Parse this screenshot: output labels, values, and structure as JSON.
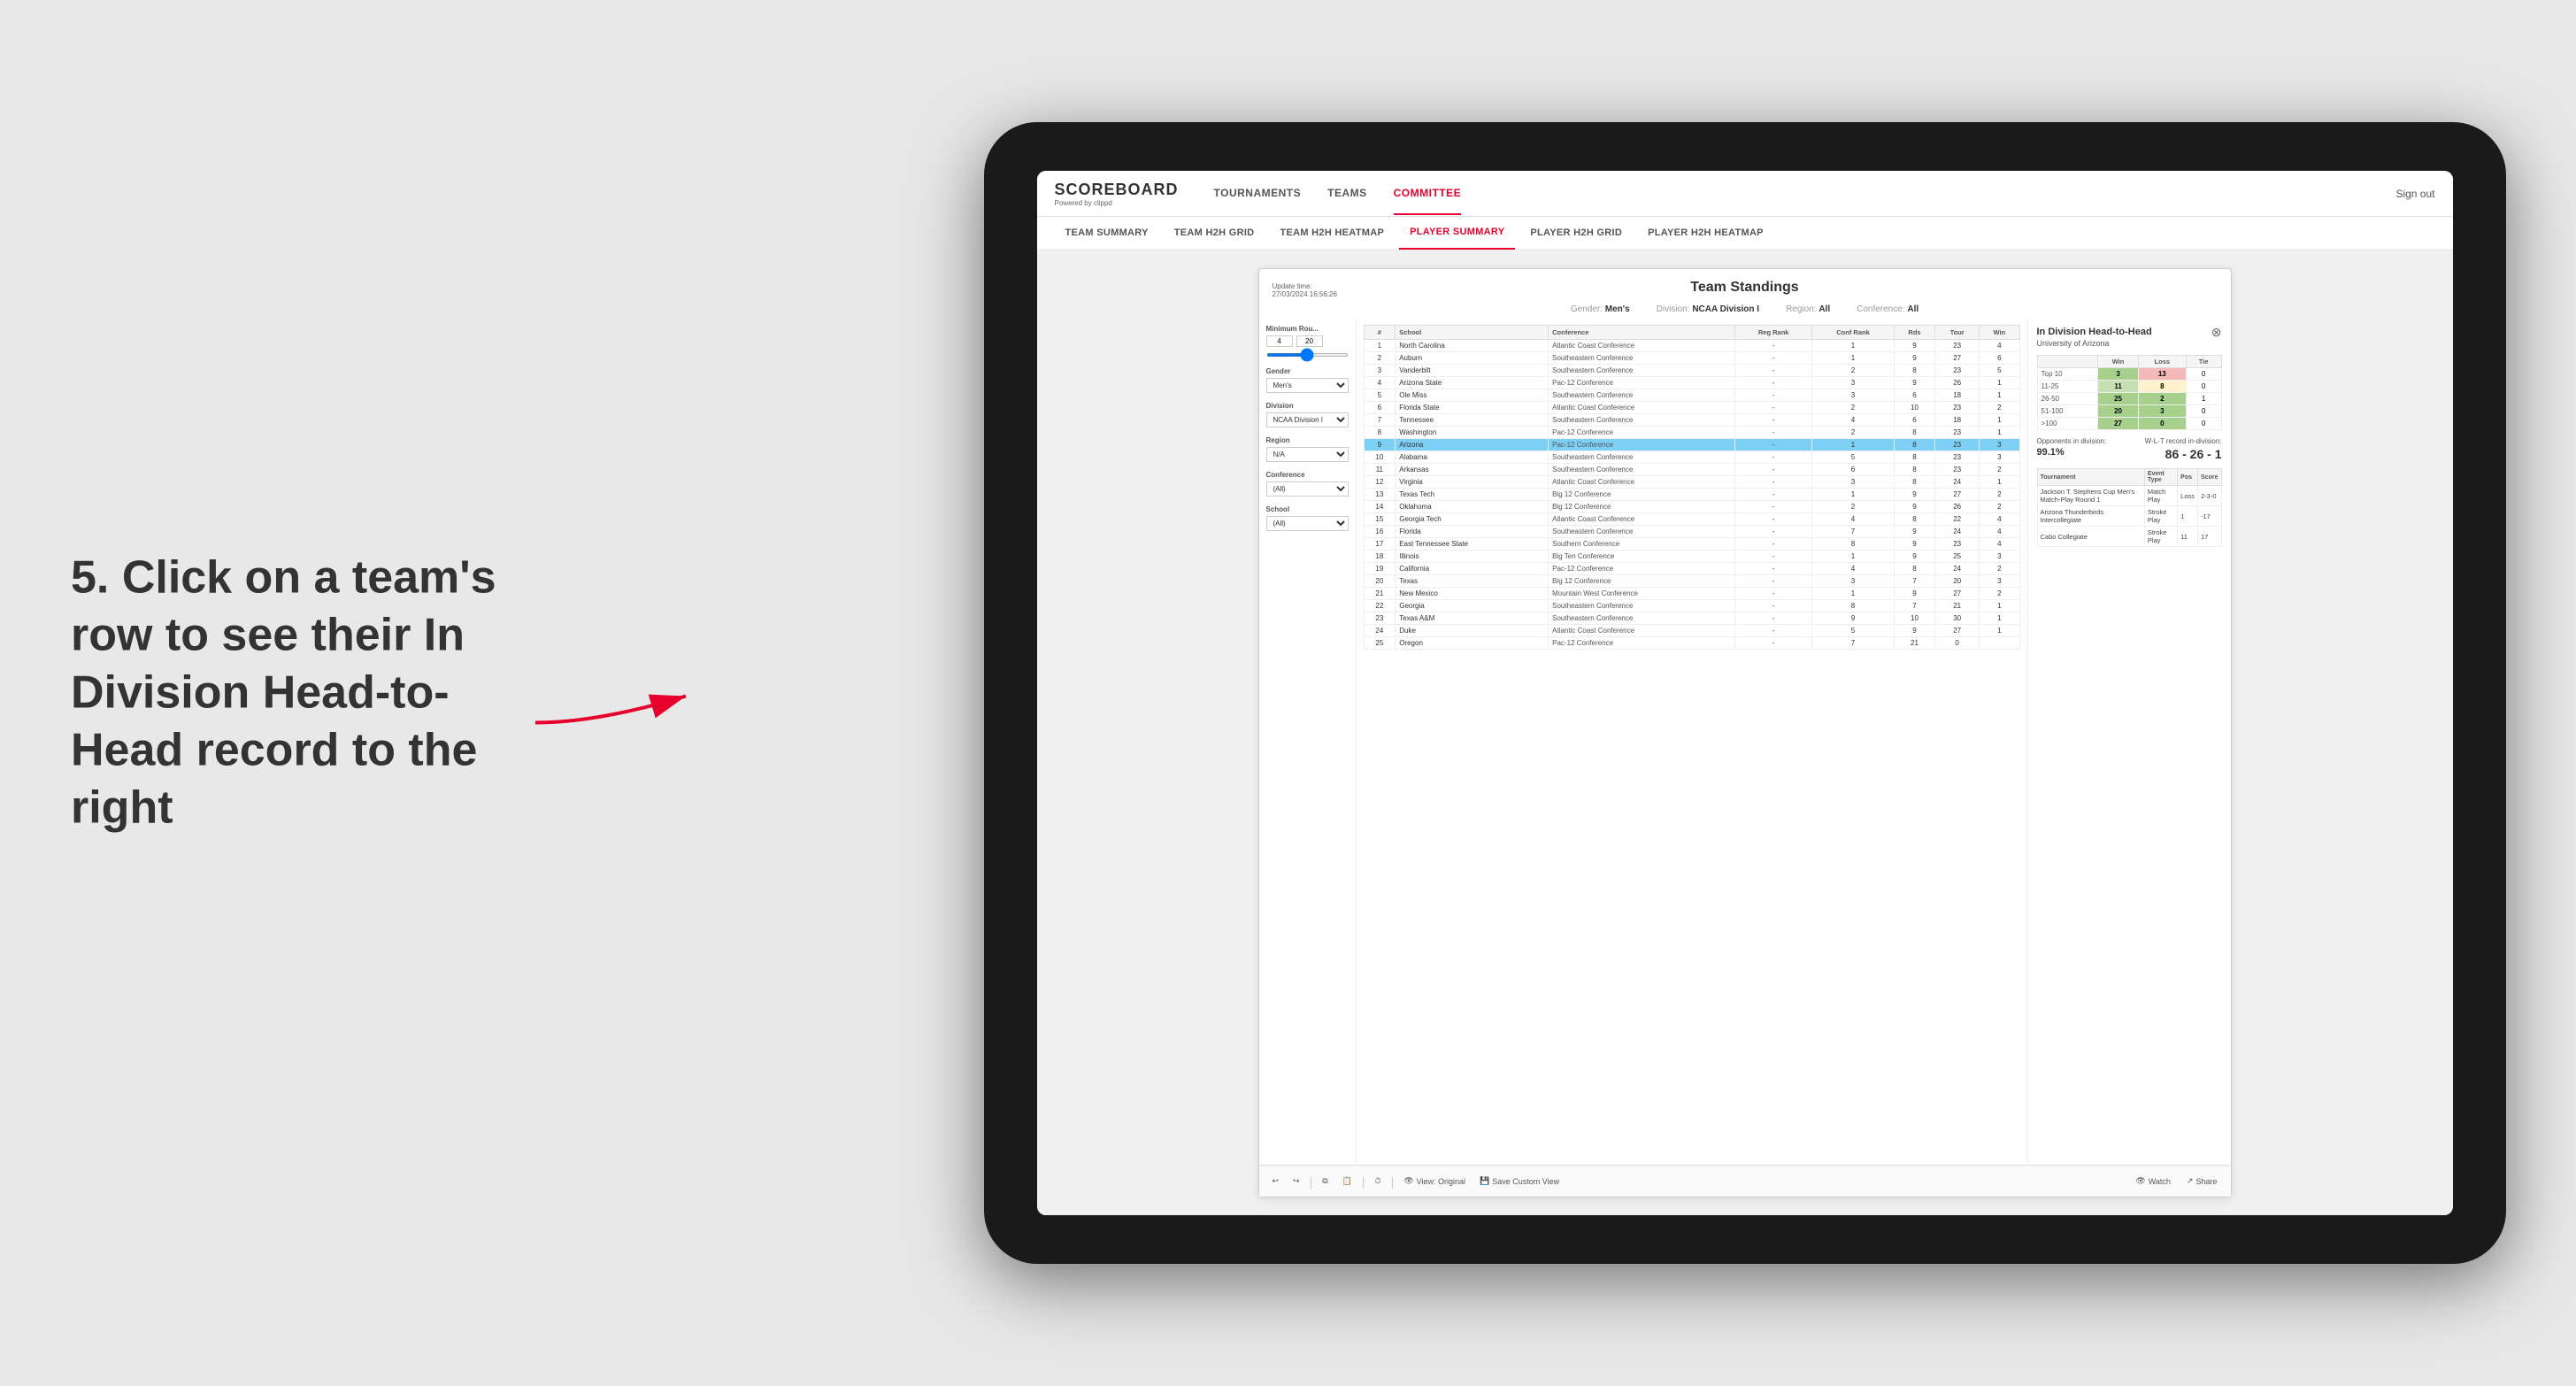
{
  "page": {
    "background": "#e8e8e8"
  },
  "annotation": {
    "text": "5. Click on a team's row to see their In Division Head-to-Head record to the right"
  },
  "nav": {
    "logo": "SCOREBOARD",
    "logo_sub": "Powered by clippd",
    "items": [
      "TOURNAMENTS",
      "TEAMS",
      "COMMITTEE"
    ],
    "active_item": "COMMITTEE",
    "sign_out": "Sign out"
  },
  "sub_nav": {
    "items": [
      "TEAM SUMMARY",
      "TEAM H2H GRID",
      "TEAM H2H HEATMAP",
      "PLAYER SUMMARY",
      "PLAYER H2H GRID",
      "PLAYER H2H HEATMAP"
    ],
    "active": "PLAYER SUMMARY"
  },
  "dashboard": {
    "update_time_label": "Update time:",
    "update_time": "27/03/2024 16:56:26",
    "title": "Team Standings",
    "gender_label": "Gender:",
    "gender": "Men's",
    "division_label": "Division:",
    "division": "NCAA Division I",
    "region_label": "Region:",
    "region": "All",
    "conference_label": "Conference:",
    "conference": "All"
  },
  "filters": {
    "min_rou_label": "Minimum Rou...",
    "min_val": "4",
    "min_max": "20",
    "gender_label": "Gender",
    "gender_val": "Men's",
    "division_label": "Division",
    "division_val": "NCAA Division I",
    "region_label": "Region",
    "region_val": "N/A",
    "conference_label": "Conference",
    "conference_val": "(All)",
    "school_label": "School",
    "school_val": "(All)"
  },
  "table": {
    "headers": [
      "#",
      "School",
      "Conference",
      "Reg Rank",
      "Conf Rank",
      "Rds",
      "Tour",
      "Win"
    ],
    "rows": [
      {
        "rank": "1",
        "school": "North Carolina",
        "conference": "Atlantic Coast Conference",
        "reg": "-",
        "conf": "1",
        "rds": "9",
        "tour": "23",
        "win": "4"
      },
      {
        "rank": "2",
        "school": "Auburn",
        "conference": "Southeastern Conference",
        "reg": "-",
        "conf": "1",
        "rds": "9",
        "tour": "27",
        "win": "6"
      },
      {
        "rank": "3",
        "school": "Vanderbilt",
        "conference": "Southeastern Conference",
        "reg": "-",
        "conf": "2",
        "rds": "8",
        "tour": "23",
        "win": "5"
      },
      {
        "rank": "4",
        "school": "Arizona State",
        "conference": "Pac-12 Conference",
        "reg": "-",
        "conf": "3",
        "rds": "9",
        "tour": "26",
        "win": "1"
      },
      {
        "rank": "5",
        "school": "Ole Miss",
        "conference": "Southeastern Conference",
        "reg": "-",
        "conf": "3",
        "rds": "6",
        "tour": "18",
        "win": "1"
      },
      {
        "rank": "6",
        "school": "Florida State",
        "conference": "Atlantic Coast Conference",
        "reg": "-",
        "conf": "2",
        "rds": "10",
        "tour": "23",
        "win": "2"
      },
      {
        "rank": "7",
        "school": "Tennessee",
        "conference": "Southeastern Conference",
        "reg": "-",
        "conf": "4",
        "rds": "6",
        "tour": "18",
        "win": "1"
      },
      {
        "rank": "8",
        "school": "Washington",
        "conference": "Pac-12 Conference",
        "reg": "-",
        "conf": "2",
        "rds": "8",
        "tour": "23",
        "win": "1"
      },
      {
        "rank": "9",
        "school": "Arizona",
        "conference": "Pac-12 Conference",
        "reg": "-",
        "conf": "1",
        "rds": "8",
        "tour": "23",
        "win": "3",
        "highlighted": true
      },
      {
        "rank": "10",
        "school": "Alabama",
        "conference": "Southeastern Conference",
        "reg": "-",
        "conf": "5",
        "rds": "8",
        "tour": "23",
        "win": "3"
      },
      {
        "rank": "11",
        "school": "Arkansas",
        "conference": "Southeastern Conference",
        "reg": "-",
        "conf": "6",
        "rds": "8",
        "tour": "23",
        "win": "2"
      },
      {
        "rank": "12",
        "school": "Virginia",
        "conference": "Atlantic Coast Conference",
        "reg": "-",
        "conf": "3",
        "rds": "8",
        "tour": "24",
        "win": "1"
      },
      {
        "rank": "13",
        "school": "Texas Tech",
        "conference": "Big 12 Conference",
        "reg": "-",
        "conf": "1",
        "rds": "9",
        "tour": "27",
        "win": "2"
      },
      {
        "rank": "14",
        "school": "Oklahoma",
        "conference": "Big 12 Conference",
        "reg": "-",
        "conf": "2",
        "rds": "9",
        "tour": "26",
        "win": "2"
      },
      {
        "rank": "15",
        "school": "Georgia Tech",
        "conference": "Atlantic Coast Conference",
        "reg": "-",
        "conf": "4",
        "rds": "8",
        "tour": "22",
        "win": "4"
      },
      {
        "rank": "16",
        "school": "Florida",
        "conference": "Southeastern Conference",
        "reg": "-",
        "conf": "7",
        "rds": "9",
        "tour": "24",
        "win": "4"
      },
      {
        "rank": "17",
        "school": "East Tennessee State",
        "conference": "Southern Conference",
        "reg": "-",
        "conf": "8",
        "rds": "9",
        "tour": "23",
        "win": "4"
      },
      {
        "rank": "18",
        "school": "Illinois",
        "conference": "Big Ten Conference",
        "reg": "-",
        "conf": "1",
        "rds": "9",
        "tour": "25",
        "win": "3"
      },
      {
        "rank": "19",
        "school": "California",
        "conference": "Pac-12 Conference",
        "reg": "-",
        "conf": "4",
        "rds": "8",
        "tour": "24",
        "win": "2"
      },
      {
        "rank": "20",
        "school": "Texas",
        "conference": "Big 12 Conference",
        "reg": "-",
        "conf": "3",
        "rds": "7",
        "tour": "20",
        "win": "3"
      },
      {
        "rank": "21",
        "school": "New Mexico",
        "conference": "Mountain West Conference",
        "reg": "-",
        "conf": "1",
        "rds": "9",
        "tour": "27",
        "win": "2"
      },
      {
        "rank": "22",
        "school": "Georgia",
        "conference": "Southeastern Conference",
        "reg": "-",
        "conf": "8",
        "rds": "7",
        "tour": "21",
        "win": "1"
      },
      {
        "rank": "23",
        "school": "Texas A&M",
        "conference": "Southeastern Conference",
        "reg": "-",
        "conf": "9",
        "rds": "10",
        "tour": "30",
        "win": "1"
      },
      {
        "rank": "24",
        "school": "Duke",
        "conference": "Atlantic Coast Conference",
        "reg": "-",
        "conf": "5",
        "rds": "9",
        "tour": "27",
        "win": "1"
      },
      {
        "rank": "25",
        "school": "Oregon",
        "conference": "Pac-12 Conference",
        "reg": "-",
        "conf": "7",
        "rds": "21",
        "tour": "0",
        "win": ""
      }
    ]
  },
  "h2h": {
    "title": "In Division Head-to-Head",
    "team": "University of Arizona",
    "win_label": "Win",
    "loss_label": "Loss",
    "tie_label": "Tie",
    "rows": [
      {
        "label": "Top 10",
        "win": "3",
        "loss": "13",
        "tie": "0",
        "win_color": "green",
        "loss_color": "red"
      },
      {
        "label": "11-25",
        "win": "11",
        "loss": "8",
        "tie": "0",
        "win_color": "light-green",
        "loss_color": "yellow"
      },
      {
        "label": "26-50",
        "win": "25",
        "loss": "2",
        "tie": "1",
        "win_color": "green",
        "loss_color": "green"
      },
      {
        "label": "51-100",
        "win": "20",
        "loss": "3",
        "tie": "0",
        "win_color": "green",
        "loss_color": "green"
      },
      {
        "label": ">100",
        "win": "27",
        "loss": "0",
        "tie": "0",
        "win_color": "green",
        "loss_color": "green"
      }
    ],
    "opponents_label": "Opponents in division:",
    "opponents_val": "99.1%",
    "wlt_label": "W-L-T record in-division:",
    "wlt_val": "86 - 26 - 1",
    "tournament_headers": [
      "Tournament",
      "Event Type",
      "Pos",
      "Score"
    ],
    "tournaments": [
      {
        "name": "Jackson T. Stephens Cup Men's Match-Play Round 1",
        "type": "Match Play",
        "pos": "Loss",
        "score": "2-3-0"
      },
      {
        "name": "Arizona Thunderbirds Intercollegiate",
        "type": "Stroke Play",
        "pos": "1",
        "score": "-17"
      },
      {
        "name": "Cabo Collegiate",
        "type": "Stroke Play",
        "pos": "11",
        "score": "17"
      }
    ]
  },
  "toolbar": {
    "view_original": "View: Original",
    "save_custom": "Save Custom View",
    "watch": "Watch",
    "share": "Share"
  }
}
